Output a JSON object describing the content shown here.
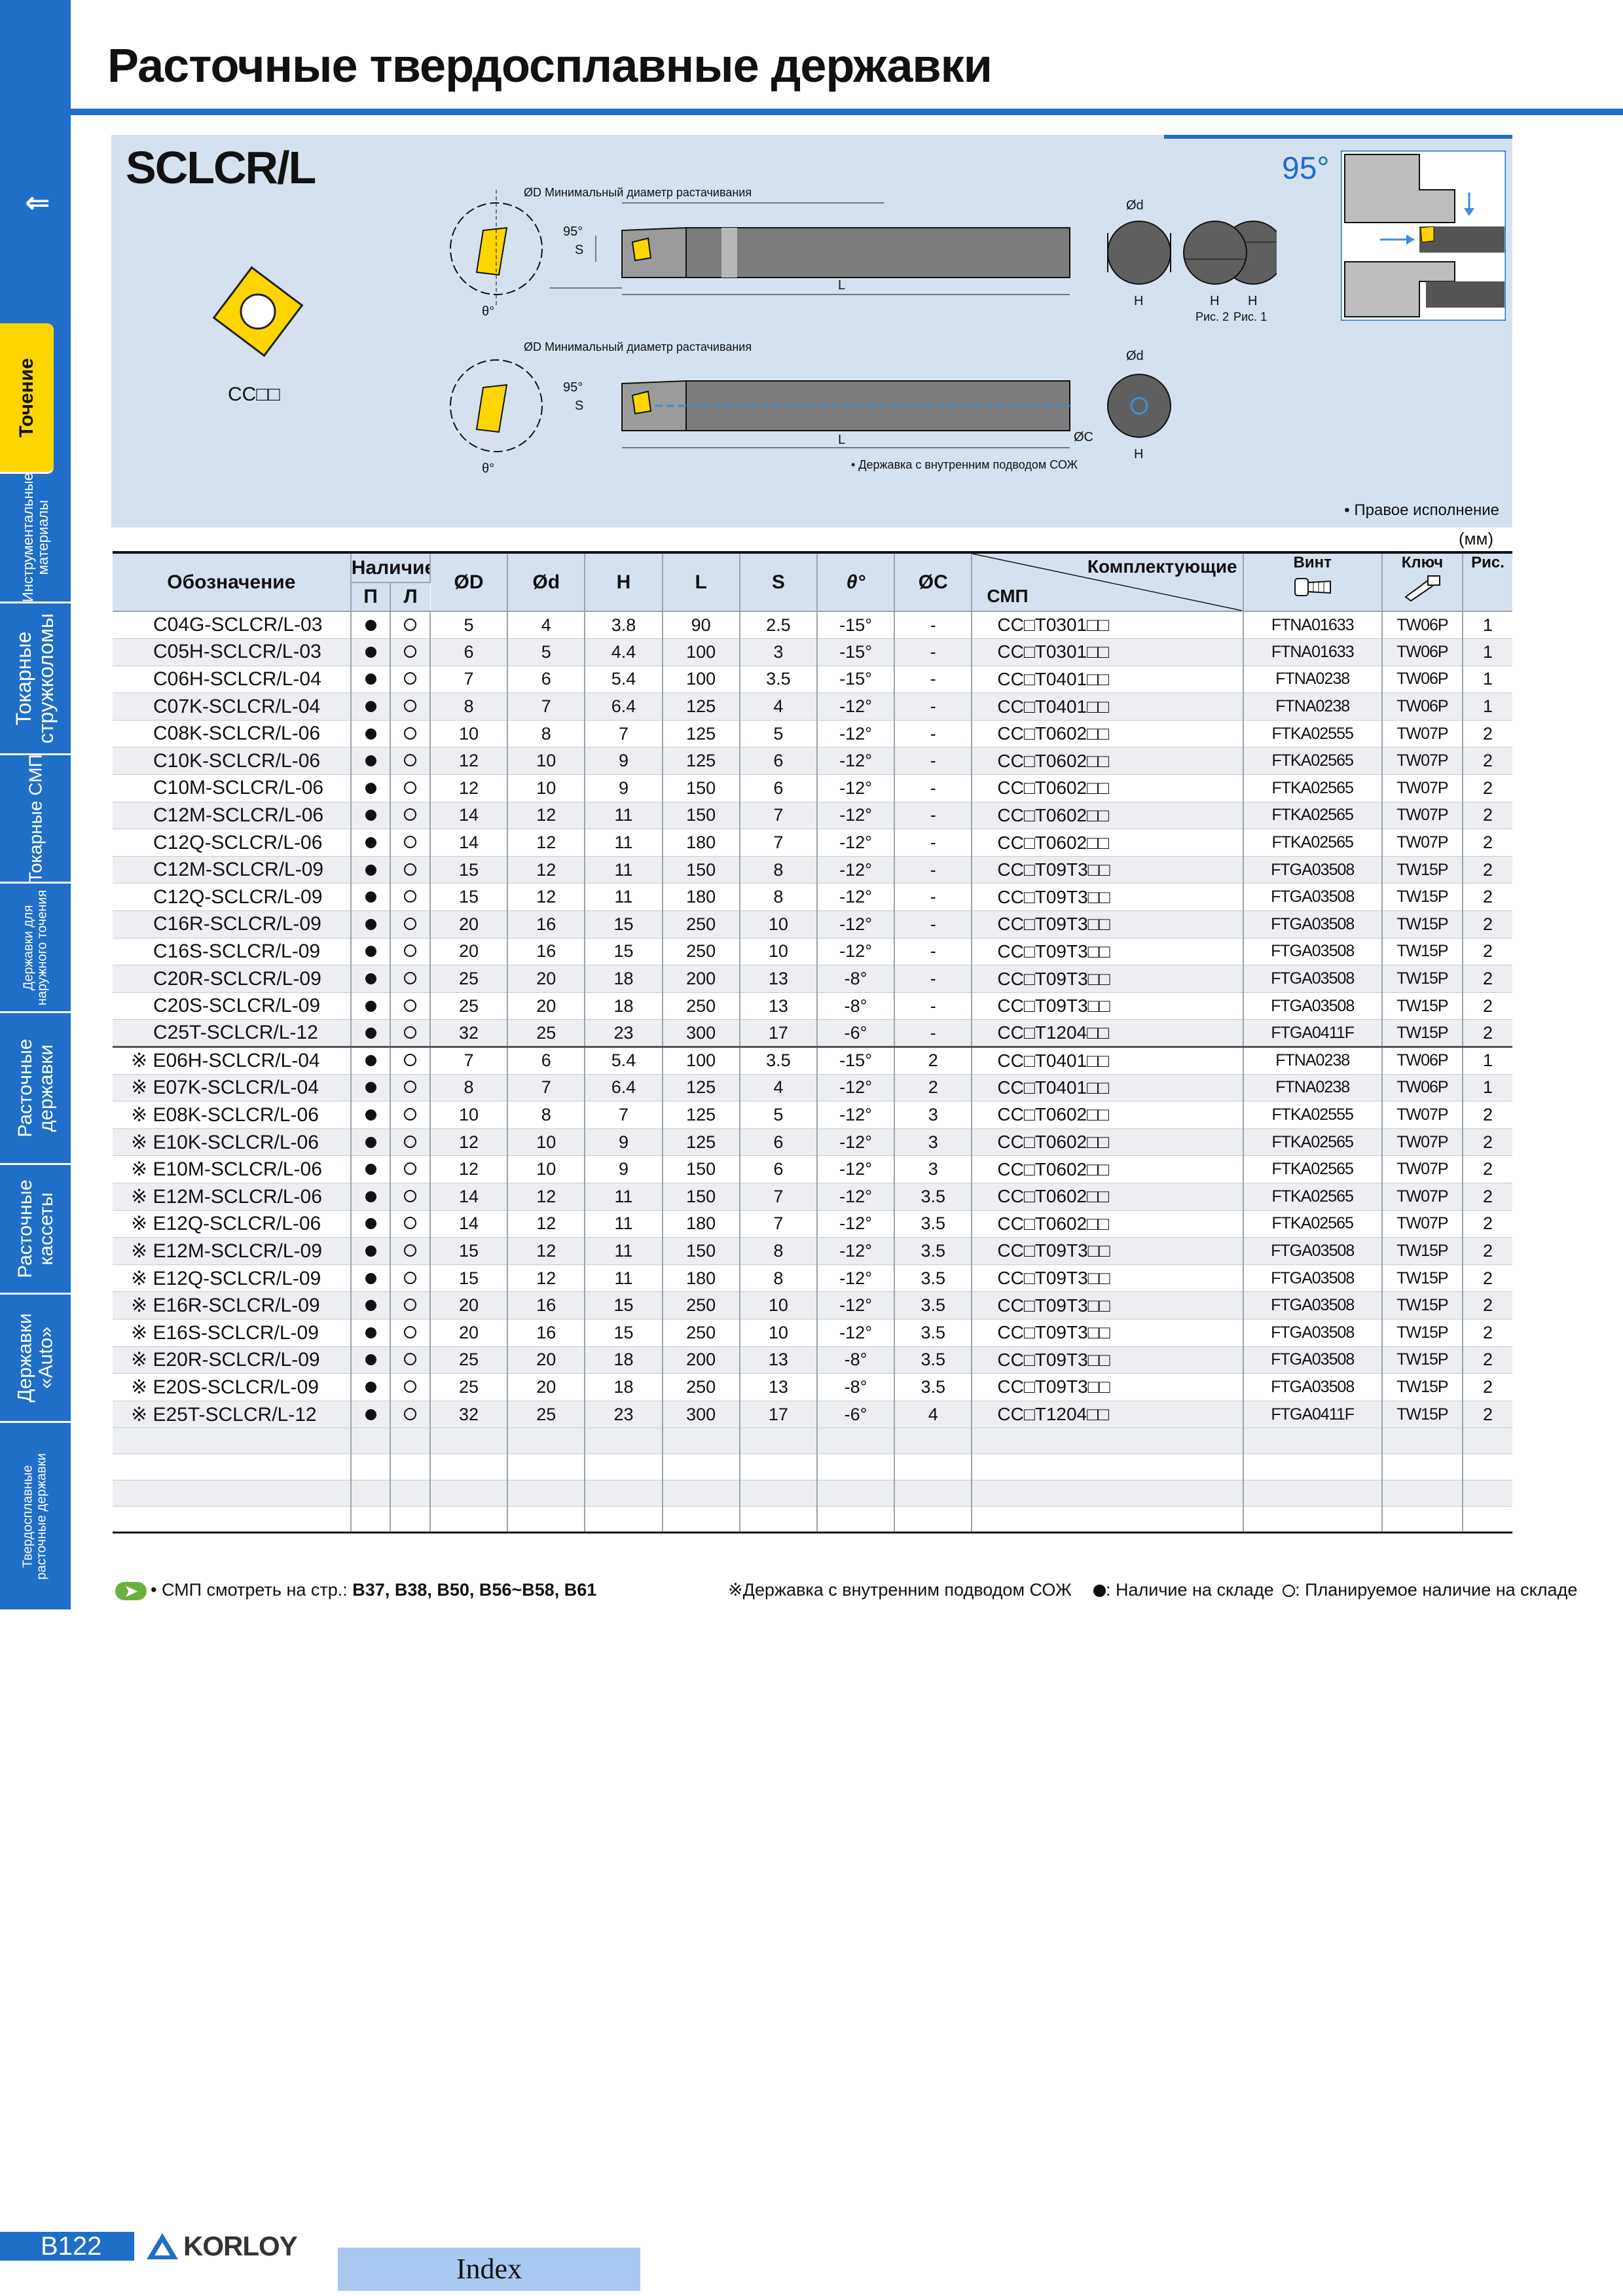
{
  "page": {
    "title": "Расточные твердосплавные державки",
    "number": "B122",
    "brand": "KORLOY",
    "index_label": "Index"
  },
  "sidebar": {
    "arrows": "⟸",
    "tabs": [
      {
        "label": "Точение",
        "active": true
      },
      {
        "label": "Инструментальные\nматериалы",
        "active": false
      },
      {
        "label": "Токарные\nстружколомы",
        "active": false
      },
      {
        "label": "Токарные СМП",
        "active": false
      },
      {
        "label": "Державки для\nнаружного точения",
        "active": false
      },
      {
        "label": "Расточные\nдержавки",
        "active": false
      },
      {
        "label": "Расточные\nкассеты",
        "active": false
      },
      {
        "label": "Державки\n«Auto»",
        "active": false
      },
      {
        "label": "Твердосплавные\nрасточные державки",
        "active": false
      }
    ]
  },
  "panel": {
    "series": "SCLCR/L",
    "insert_label": "CC□□",
    "angle": "95°",
    "right_note": "• Правое исполнение",
    "unit": "(мм)",
    "diagram": {
      "min_bore_label": "ØD Минимальный диаметр растачивания",
      "angle_95": "95°",
      "label_s": "S",
      "label_theta": "θ°",
      "label_L": "L",
      "label_d": "Ød",
      "label_H": "H",
      "label_C": "ØC",
      "fig1": "Рис. 1",
      "fig2": "Рис. 2",
      "coolant_note": "• Державка с внутренним подводом СОЖ"
    }
  },
  "table": {
    "headers": {
      "designation": "Обозначение",
      "stock": "Наличие",
      "stock_r": "П",
      "stock_l": "Л",
      "D": "ØD",
      "d": "Ød",
      "H": "H",
      "L": "L",
      "S": "S",
      "theta": "θ°",
      "C": "ØC",
      "components": "Комплектующие",
      "insert": "СМП",
      "screw": "Винт",
      "key": "Ключ",
      "fig": "Рис."
    },
    "rows": [
      {
        "code": "C04G-SCLCR/L-03",
        "r": "●",
        "l": "○",
        "D": "5",
        "d": "4",
        "H": "3.8",
        "L": "90",
        "S": "2.5",
        "theta": "-15°",
        "C": "-",
        "insert": "CC□T0301□□",
        "screw": "FTNA01633",
        "key": "TW06P",
        "fig": "1"
      },
      {
        "code": "C05H-SCLCR/L-03",
        "r": "●",
        "l": "○",
        "D": "6",
        "d": "5",
        "H": "4.4",
        "L": "100",
        "S": "3",
        "theta": "-15°",
        "C": "-",
        "insert": "CC□T0301□□",
        "screw": "FTNA01633",
        "key": "TW06P",
        "fig": "1"
      },
      {
        "code": "C06H-SCLCR/L-04",
        "r": "●",
        "l": "○",
        "D": "7",
        "d": "6",
        "H": "5.4",
        "L": "100",
        "S": "3.5",
        "theta": "-15°",
        "C": "-",
        "insert": "CC□T0401□□",
        "screw": "FTNA0238",
        "key": "TW06P",
        "fig": "1"
      },
      {
        "code": "C07K-SCLCR/L-04",
        "r": "●",
        "l": "○",
        "D": "8",
        "d": "7",
        "H": "6.4",
        "L": "125",
        "S": "4",
        "theta": "-12°",
        "C": "-",
        "insert": "CC□T0401□□",
        "screw": "FTNA0238",
        "key": "TW06P",
        "fig": "1"
      },
      {
        "code": "C08K-SCLCR/L-06",
        "r": "●",
        "l": "○",
        "D": "10",
        "d": "8",
        "H": "7",
        "L": "125",
        "S": "5",
        "theta": "-12°",
        "C": "-",
        "insert": "CC□T0602□□",
        "screw": "FTKA02555",
        "key": "TW07P",
        "fig": "2"
      },
      {
        "code": "C10K-SCLCR/L-06",
        "r": "●",
        "l": "○",
        "D": "12",
        "d": "10",
        "H": "9",
        "L": "125",
        "S": "6",
        "theta": "-12°",
        "C": "-",
        "insert": "CC□T0602□□",
        "screw": "FTKA02565",
        "key": "TW07P",
        "fig": "2"
      },
      {
        "code": "C10M-SCLCR/L-06",
        "r": "●",
        "l": "○",
        "D": "12",
        "d": "10",
        "H": "9",
        "L": "150",
        "S": "6",
        "theta": "-12°",
        "C": "-",
        "insert": "CC□T0602□□",
        "screw": "FTKA02565",
        "key": "TW07P",
        "fig": "2"
      },
      {
        "code": "C12M-SCLCR/L-06",
        "r": "●",
        "l": "○",
        "D": "14",
        "d": "12",
        "H": "11",
        "L": "150",
        "S": "7",
        "theta": "-12°",
        "C": "-",
        "insert": "CC□T0602□□",
        "screw": "FTKA02565",
        "key": "TW07P",
        "fig": "2"
      },
      {
        "code": "C12Q-SCLCR/L-06",
        "r": "●",
        "l": "○",
        "D": "14",
        "d": "12",
        "H": "11",
        "L": "180",
        "S": "7",
        "theta": "-12°",
        "C": "-",
        "insert": "CC□T0602□□",
        "screw": "FTKA02565",
        "key": "TW07P",
        "fig": "2"
      },
      {
        "code": "C12M-SCLCR/L-09",
        "r": "●",
        "l": "○",
        "D": "15",
        "d": "12",
        "H": "11",
        "L": "150",
        "S": "8",
        "theta": "-12°",
        "C": "-",
        "insert": "CC□T09T3□□",
        "screw": "FTGA03508",
        "key": "TW15P",
        "fig": "2"
      },
      {
        "code": "C12Q-SCLCR/L-09",
        "r": "●",
        "l": "○",
        "D": "15",
        "d": "12",
        "H": "11",
        "L": "180",
        "S": "8",
        "theta": "-12°",
        "C": "-",
        "insert": "CC□T09T3□□",
        "screw": "FTGA03508",
        "key": "TW15P",
        "fig": "2"
      },
      {
        "code": "C16R-SCLCR/L-09",
        "r": "●",
        "l": "○",
        "D": "20",
        "d": "16",
        "H": "15",
        "L": "250",
        "S": "10",
        "theta": "-12°",
        "C": "-",
        "insert": "CC□T09T3□□",
        "screw": "FTGA03508",
        "key": "TW15P",
        "fig": "2"
      },
      {
        "code": "C16S-SCLCR/L-09",
        "r": "●",
        "l": "○",
        "D": "20",
        "d": "16",
        "H": "15",
        "L": "250",
        "S": "10",
        "theta": "-12°",
        "C": "-",
        "insert": "CC□T09T3□□",
        "screw": "FTGA03508",
        "key": "TW15P",
        "fig": "2"
      },
      {
        "code": "C20R-SCLCR/L-09",
        "r": "●",
        "l": "○",
        "D": "25",
        "d": "20",
        "H": "18",
        "L": "200",
        "S": "13",
        "theta": "-8°",
        "C": "-",
        "insert": "CC□T09T3□□",
        "screw": "FTGA03508",
        "key": "TW15P",
        "fig": "2"
      },
      {
        "code": "C20S-SCLCR/L-09",
        "r": "●",
        "l": "○",
        "D": "25",
        "d": "20",
        "H": "18",
        "L": "250",
        "S": "13",
        "theta": "-8°",
        "C": "-",
        "insert": "CC□T09T3□□",
        "screw": "FTGA03508",
        "key": "TW15P",
        "fig": "2"
      },
      {
        "code": "C25T-SCLCR/L-12",
        "r": "●",
        "l": "○",
        "D": "32",
        "d": "25",
        "H": "23",
        "L": "300",
        "S": "17",
        "theta": "-6°",
        "C": "-",
        "insert": "CC□T1204□□",
        "screw": "FTGA0411F",
        "key": "TW15P",
        "fig": "2"
      },
      {
        "code": "※ E06H-SCLCR/L-04",
        "r": "●",
        "l": "○",
        "D": "7",
        "d": "6",
        "H": "5.4",
        "L": "100",
        "S": "3.5",
        "theta": "-15°",
        "C": "2",
        "insert": "CC□T0401□□",
        "screw": "FTNA0238",
        "key": "TW06P",
        "fig": "1"
      },
      {
        "code": "※ E07K-SCLCR/L-04",
        "r": "●",
        "l": "○",
        "D": "8",
        "d": "7",
        "H": "6.4",
        "L": "125",
        "S": "4",
        "theta": "-12°",
        "C": "2",
        "insert": "CC□T0401□□",
        "screw": "FTNA0238",
        "key": "TW06P",
        "fig": "1"
      },
      {
        "code": "※ E08K-SCLCR/L-06",
        "r": "●",
        "l": "○",
        "D": "10",
        "d": "8",
        "H": "7",
        "L": "125",
        "S": "5",
        "theta": "-12°",
        "C": "3",
        "insert": "CC□T0602□□",
        "screw": "FTKA02555",
        "key": "TW07P",
        "fig": "2"
      },
      {
        "code": "※ E10K-SCLCR/L-06",
        "r": "●",
        "l": "○",
        "D": "12",
        "d": "10",
        "H": "9",
        "L": "125",
        "S": "6",
        "theta": "-12°",
        "C": "3",
        "insert": "CC□T0602□□",
        "screw": "FTKA02565",
        "key": "TW07P",
        "fig": "2"
      },
      {
        "code": "※ E10M-SCLCR/L-06",
        "r": "●",
        "l": "○",
        "D": "12",
        "d": "10",
        "H": "9",
        "L": "150",
        "S": "6",
        "theta": "-12°",
        "C": "3",
        "insert": "CC□T0602□□",
        "screw": "FTKA02565",
        "key": "TW07P",
        "fig": "2"
      },
      {
        "code": "※ E12M-SCLCR/L-06",
        "r": "●",
        "l": "○",
        "D": "14",
        "d": "12",
        "H": "11",
        "L": "150",
        "S": "7",
        "theta": "-12°",
        "C": "3.5",
        "insert": "CC□T0602□□",
        "screw": "FTKA02565",
        "key": "TW07P",
        "fig": "2"
      },
      {
        "code": "※ E12Q-SCLCR/L-06",
        "r": "●",
        "l": "○",
        "D": "14",
        "d": "12",
        "H": "11",
        "L": "180",
        "S": "7",
        "theta": "-12°",
        "C": "3.5",
        "insert": "CC□T0602□□",
        "screw": "FTKA02565",
        "key": "TW07P",
        "fig": "2"
      },
      {
        "code": "※ E12M-SCLCR/L-09",
        "r": "●",
        "l": "○",
        "D": "15",
        "d": "12",
        "H": "11",
        "L": "150",
        "S": "8",
        "theta": "-12°",
        "C": "3.5",
        "insert": "CC□T09T3□□",
        "screw": "FTGA03508",
        "key": "TW15P",
        "fig": "2"
      },
      {
        "code": "※ E12Q-SCLCR/L-09",
        "r": "●",
        "l": "○",
        "D": "15",
        "d": "12",
        "H": "11",
        "L": "180",
        "S": "8",
        "theta": "-12°",
        "C": "3.5",
        "insert": "CC□T09T3□□",
        "screw": "FTGA03508",
        "key": "TW15P",
        "fig": "2"
      },
      {
        "code": "※ E16R-SCLCR/L-09",
        "r": "●",
        "l": "○",
        "D": "20",
        "d": "16",
        "H": "15",
        "L": "250",
        "S": "10",
        "theta": "-12°",
        "C": "3.5",
        "insert": "CC□T09T3□□",
        "screw": "FTGA03508",
        "key": "TW15P",
        "fig": "2"
      },
      {
        "code": "※ E16S-SCLCR/L-09",
        "r": "●",
        "l": "○",
        "D": "20",
        "d": "16",
        "H": "15",
        "L": "250",
        "S": "10",
        "theta": "-12°",
        "C": "3.5",
        "insert": "CC□T09T3□□",
        "screw": "FTGA03508",
        "key": "TW15P",
        "fig": "2"
      },
      {
        "code": "※ E20R-SCLCR/L-09",
        "r": "●",
        "l": "○",
        "D": "25",
        "d": "20",
        "H": "18",
        "L": "200",
        "S": "13",
        "theta": "-8°",
        "C": "3.5",
        "insert": "CC□T09T3□□",
        "screw": "FTGA03508",
        "key": "TW15P",
        "fig": "2"
      },
      {
        "code": "※ E20S-SCLCR/L-09",
        "r": "●",
        "l": "○",
        "D": "25",
        "d": "20",
        "H": "18",
        "L": "250",
        "S": "13",
        "theta": "-8°",
        "C": "3.5",
        "insert": "CC□T09T3□□",
        "screw": "FTGA03508",
        "key": "TW15P",
        "fig": "2"
      },
      {
        "code": "※ E25T-SCLCR/L-12",
        "r": "●",
        "l": "○",
        "D": "32",
        "d": "25",
        "H": "23",
        "L": "300",
        "S": "17",
        "theta": "-6°",
        "C": "4",
        "insert": "CC□T1204□□",
        "screw": "FTGA0411F",
        "key": "TW15P",
        "fig": "2"
      }
    ],
    "blank_rows": 4
  },
  "footer": {
    "insert_ref_prefix": "• СМП смотреть на стр.: ",
    "insert_ref_pages": "B37, B38, B50, B56~B58, B61",
    "coolant_note": "※Державка с внутренним подводом СОЖ",
    "legend_in_stock": ": Наличие на складе",
    "legend_planned": ": Планируемое наличие на складе"
  }
}
